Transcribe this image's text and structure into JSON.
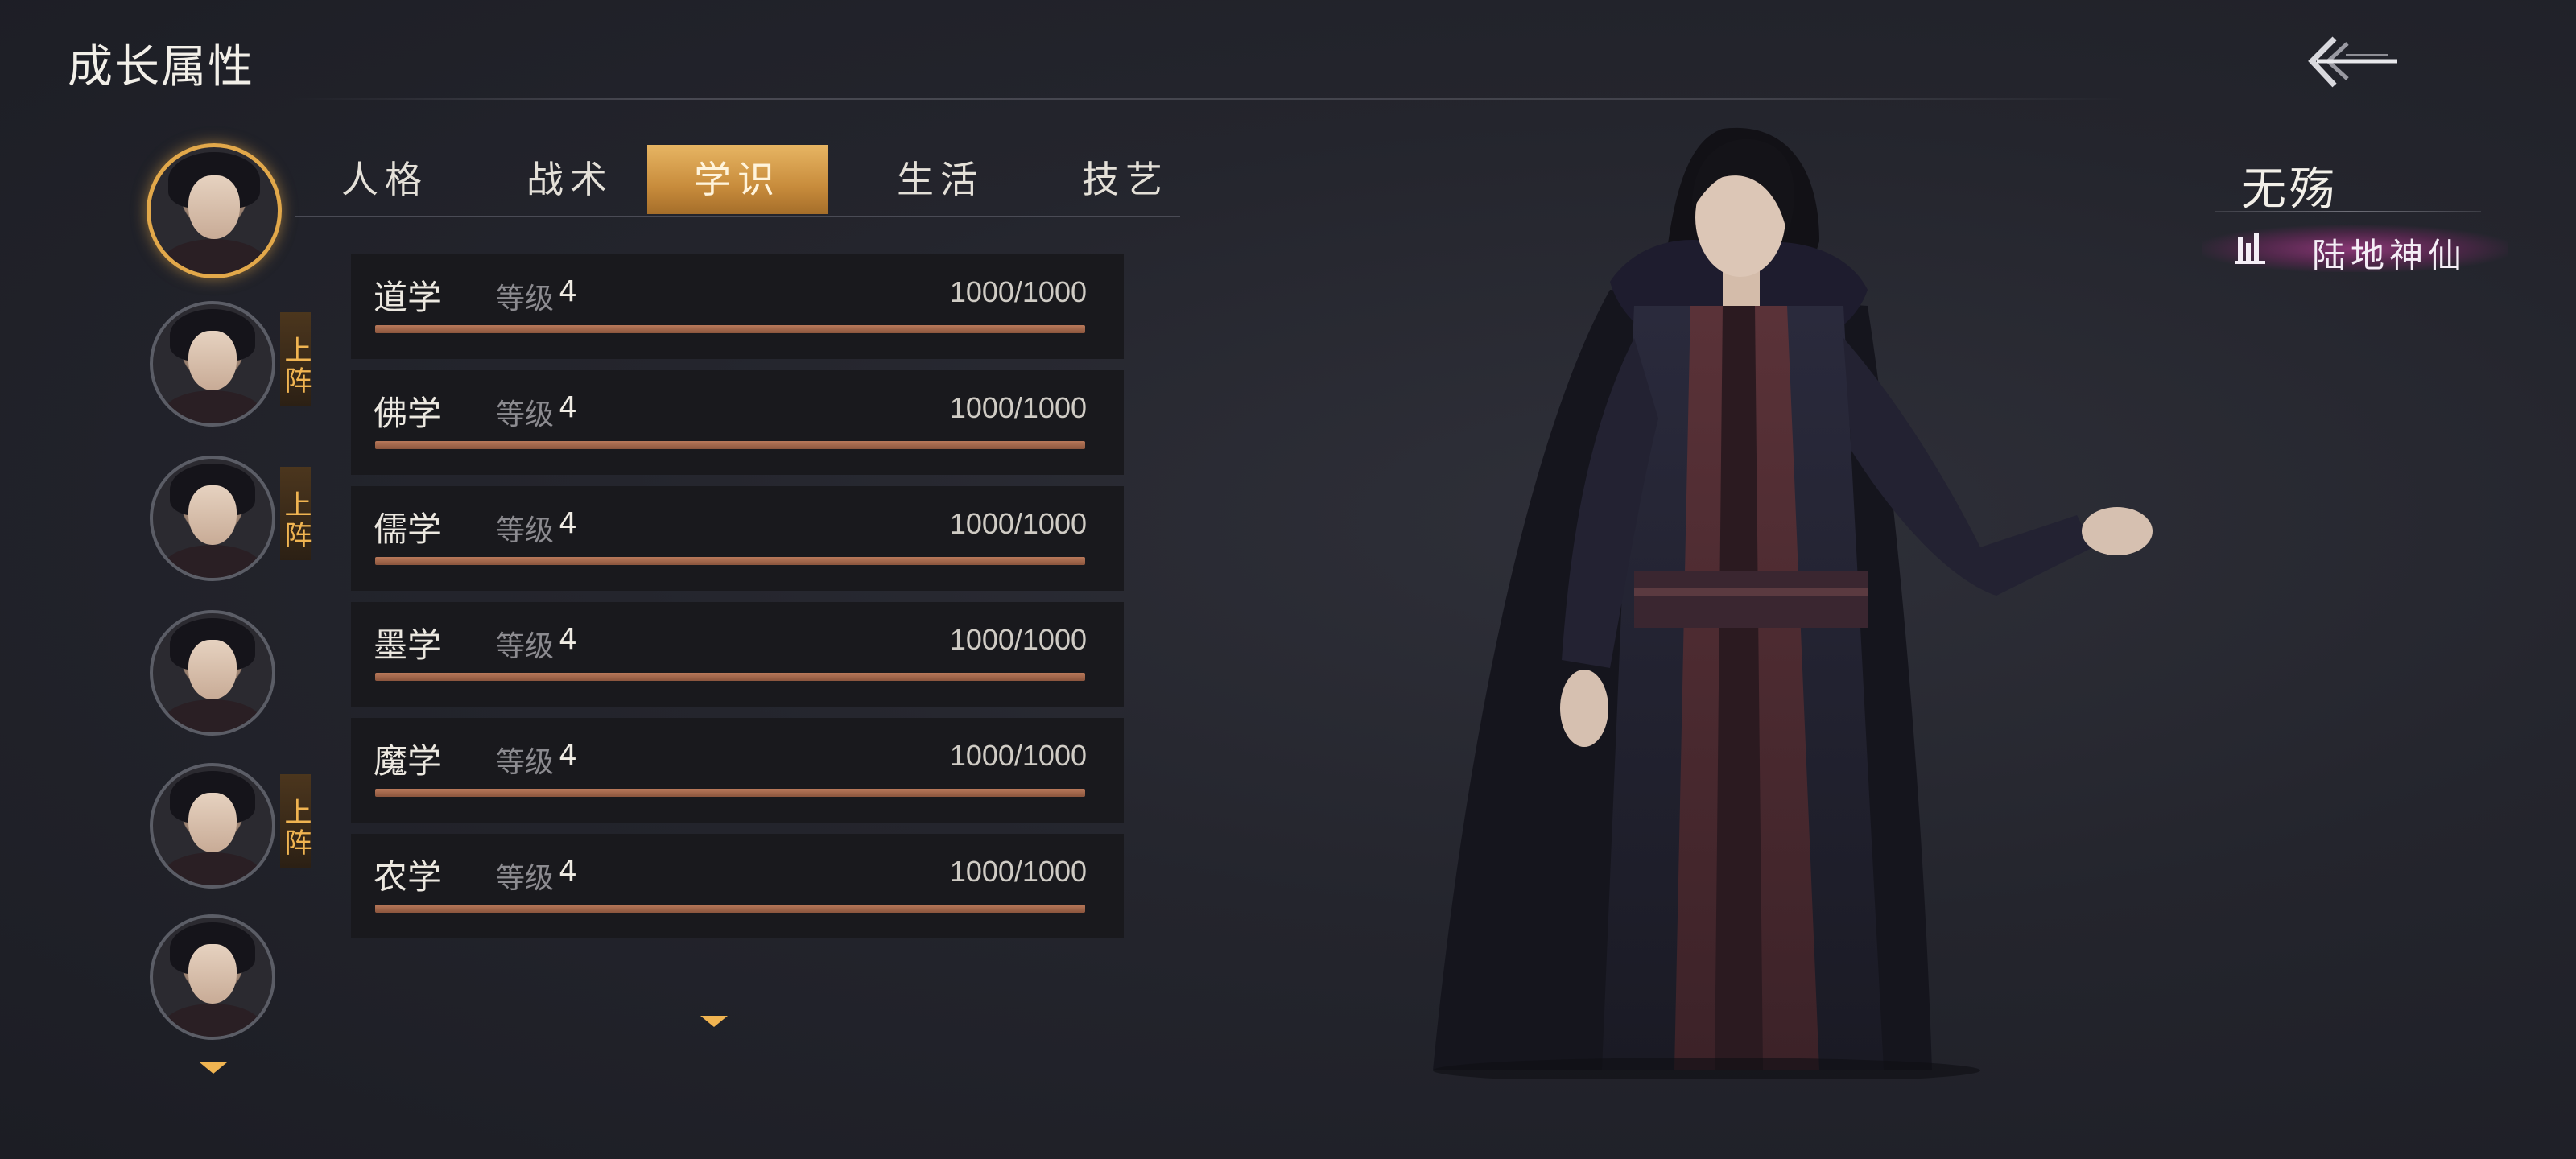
{
  "header": {
    "title": "成长属性"
  },
  "tabs": [
    {
      "label": "人格",
      "active": false
    },
    {
      "label": "战术",
      "active": false
    },
    {
      "label": "学识",
      "active": true
    },
    {
      "label": "生活",
      "active": false
    },
    {
      "label": "技艺",
      "active": false
    }
  ],
  "portraits": {
    "deploy_badge": "上阵",
    "items": [
      {
        "selected": true,
        "deployed": false
      },
      {
        "selected": false,
        "deployed": true
      },
      {
        "selected": false,
        "deployed": true
      },
      {
        "selected": false,
        "deployed": false
      },
      {
        "selected": false,
        "deployed": true
      },
      {
        "selected": false,
        "deployed": false
      }
    ]
  },
  "skills": {
    "level_label": "等级",
    "rows": [
      {
        "name": "道学",
        "level": "4",
        "progress_text": "1000/1000",
        "progress": 1.0
      },
      {
        "name": "佛学",
        "level": "4",
        "progress_text": "1000/1000",
        "progress": 1.0
      },
      {
        "name": "儒学",
        "level": "4",
        "progress_text": "1000/1000",
        "progress": 1.0
      },
      {
        "name": "墨学",
        "level": "4",
        "progress_text": "1000/1000",
        "progress": 1.0
      },
      {
        "name": "魔学",
        "level": "4",
        "progress_text": "1000/1000",
        "progress": 1.0
      },
      {
        "name": "农学",
        "level": "4",
        "progress_text": "1000/1000",
        "progress": 1.0
      }
    ]
  },
  "character": {
    "name": "无殇",
    "rank_title": "陆地神仙"
  },
  "icons": {
    "back": "back-arrow-icon",
    "scroll_down": "chevron-down-icon",
    "rank": "rank-icon"
  },
  "colors": {
    "accent": "#e2a84a",
    "progress_fill": "#a4694c",
    "badge_text": "#f0b451",
    "title_glow": "#aa3c8c"
  }
}
